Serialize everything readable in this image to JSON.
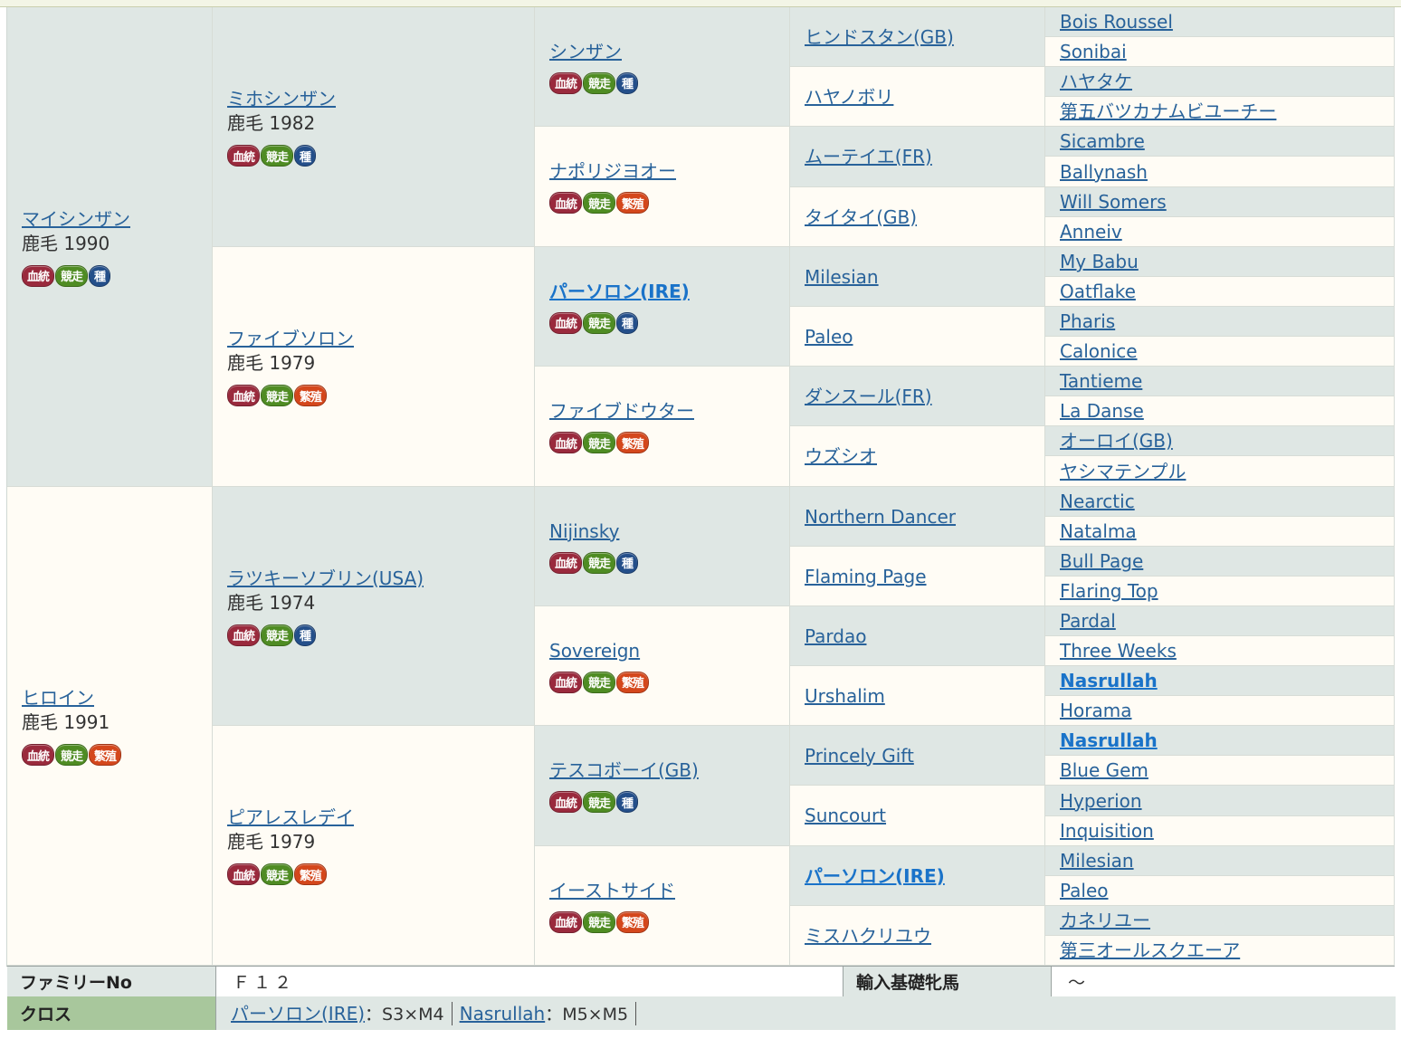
{
  "badges": {
    "blood": "血統",
    "race": "競走",
    "sire": "種",
    "breed": "繁殖"
  },
  "pedigree": {
    "g1": [
      {
        "name": "マイシンザン",
        "sub": "鹿毛 1990",
        "badges": [
          "blood",
          "race",
          "sire"
        ]
      },
      {
        "name": "ヒロイン",
        "sub": "鹿毛 1991",
        "badges": [
          "blood",
          "race",
          "breed"
        ]
      }
    ],
    "g2": [
      {
        "name": "ミホシンザン",
        "sub": "鹿毛 1982",
        "badges": [
          "blood",
          "race",
          "sire"
        ]
      },
      {
        "name": "ファイブソロン",
        "sub": "鹿毛 1979",
        "badges": [
          "blood",
          "race",
          "breed"
        ]
      },
      {
        "name": "ラツキーソブリン(USA)",
        "sub": "鹿毛 1974",
        "badges": [
          "blood",
          "race",
          "sire"
        ]
      },
      {
        "name": "ピアレスレデイ",
        "sub": "鹿毛 1979",
        "badges": [
          "blood",
          "race",
          "breed"
        ]
      }
    ],
    "g3": [
      {
        "name": "シンザン",
        "badges": [
          "blood",
          "race",
          "sire"
        ]
      },
      {
        "name": "ナポリジヨオー",
        "badges": [
          "blood",
          "race",
          "breed"
        ]
      },
      {
        "name": "パーソロン(IRE)",
        "bold": true,
        "badges": [
          "blood",
          "race",
          "sire"
        ]
      },
      {
        "name": "ファイブドウター",
        "badges": [
          "blood",
          "race",
          "breed"
        ]
      },
      {
        "name": "Nijinsky",
        "badges": [
          "blood",
          "race",
          "sire"
        ]
      },
      {
        "name": "Sovereign",
        "badges": [
          "blood",
          "race",
          "breed"
        ]
      },
      {
        "name": "テスコボーイ(GB)",
        "badges": [
          "blood",
          "race",
          "sire"
        ]
      },
      {
        "name": "イーストサイド",
        "badges": [
          "blood",
          "race",
          "breed"
        ]
      }
    ],
    "g4": [
      {
        "name": "ヒンドスタン(GB)"
      },
      {
        "name": "ハヤノボリ"
      },
      {
        "name": "ムーテイエ(FR)"
      },
      {
        "name": "タイタイ(GB)"
      },
      {
        "name": "Milesian"
      },
      {
        "name": "Paleo"
      },
      {
        "name": "ダンスール(FR)"
      },
      {
        "name": "ウズシオ"
      },
      {
        "name": "Northern Dancer"
      },
      {
        "name": "Flaming Page"
      },
      {
        "name": "Pardao"
      },
      {
        "name": "Urshalim"
      },
      {
        "name": "Princely Gift"
      },
      {
        "name": "Suncourt"
      },
      {
        "name": "パーソロン(IRE)",
        "bold": true
      },
      {
        "name": "ミスハクリユウ"
      }
    ],
    "g5": [
      {
        "name": "Bois Roussel"
      },
      {
        "name": "Sonibai"
      },
      {
        "name": "ハヤタケ"
      },
      {
        "name": "第五バツカナムビユーチー"
      },
      {
        "name": "Sicambre"
      },
      {
        "name": "Ballynash"
      },
      {
        "name": "Will Somers"
      },
      {
        "name": "Anneiv"
      },
      {
        "name": "My Babu"
      },
      {
        "name": "Oatflake"
      },
      {
        "name": "Pharis"
      },
      {
        "name": "Calonice"
      },
      {
        "name": "Tantieme"
      },
      {
        "name": "La Danse"
      },
      {
        "name": "オーロイ(GB)"
      },
      {
        "name": "ヤシマテンプル"
      },
      {
        "name": "Nearctic"
      },
      {
        "name": "Natalma"
      },
      {
        "name": "Bull Page"
      },
      {
        "name": "Flaring Top"
      },
      {
        "name": "Pardal"
      },
      {
        "name": "Three Weeks"
      },
      {
        "name": "Nasrullah",
        "bold": true
      },
      {
        "name": "Horama"
      },
      {
        "name": "Nasrullah",
        "bold": true
      },
      {
        "name": "Blue Gem"
      },
      {
        "name": "Hyperion"
      },
      {
        "name": "Inquisition"
      },
      {
        "name": "Milesian"
      },
      {
        "name": "Paleo"
      },
      {
        "name": "カネリユー"
      },
      {
        "name": "第三オールスクエーア"
      }
    ]
  },
  "info": {
    "family_label": "ファミリーNo",
    "family_value": "Ｆ１２",
    "import_label": "輸入基礎牝馬",
    "import_value": "～",
    "cross_label": "クロス",
    "crosses": [
      {
        "name": "パーソロン(IRE)",
        "value": "：S3×M4"
      },
      {
        "name": "Nasrullah",
        "value": "：M5×M5"
      }
    ]
  },
  "colors": {
    "male_bg": "#dfe7e4",
    "female_bg": "#fffcf5",
    "link": "#28629a",
    "link_bold": "#1a73c9",
    "badge_blood": "#9a2a3d",
    "badge_race": "#4f8c23",
    "badge_sire": "#244f8a",
    "badge_breed": "#d4471c",
    "cross_header": "#a8c79c"
  }
}
